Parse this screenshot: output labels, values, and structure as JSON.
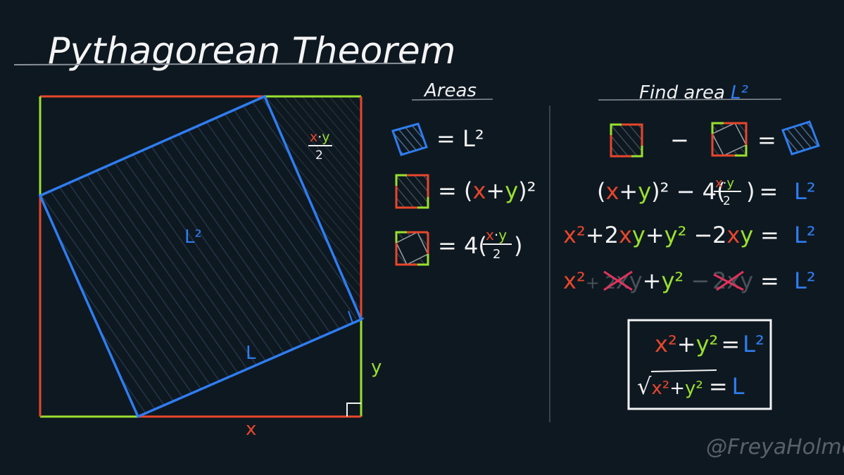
{
  "title": "Pythagorean Theorem",
  "headers": {
    "areas": "Areas",
    "find_area": "Find area",
    "find_area_symbol": "L²"
  },
  "labels": {
    "L_squared": "L²",
    "L": "L",
    "x": "x",
    "y": "y",
    "triangle_num": "x·y",
    "triangle_den": "2"
  },
  "areas": {
    "row1": {
      "rhs": "= L²"
    },
    "row2": {
      "eq": "= (",
      "x": "x",
      "plus": "+",
      "y": "y",
      "close": ")²"
    },
    "row3": {
      "eq": "= 4(",
      "num_x": "x",
      "dot": "·",
      "num_y": "y",
      "den": "2",
      "close": ")"
    }
  },
  "find": {
    "minus": "−",
    "equals": "=",
    "line2": {
      "open": "(",
      "x": "x",
      "plus": "+",
      "y": "y",
      "close": ")² − 4(",
      "num_x": "x",
      "dot": "·",
      "num_y": "y",
      "den": "2",
      "end": ")",
      "eq": "=",
      "rhs": "L²"
    },
    "line3": {
      "x2": "x²",
      "plus1": "+2",
      "xy_x": "x",
      "xy_y": "y",
      "plus2": "+",
      "y2": "y²",
      "minus": " −",
      "two": "2",
      "x": "x",
      "y": "y",
      "eq": "=",
      "rhs": "L²"
    },
    "line4": {
      "x2": "x²",
      "plus1": "+ 2",
      "x": "x",
      "y": "y",
      "plus2": "+",
      "y2": "y²",
      "minus": " −",
      "two": "2",
      "x2b": "x",
      "y2b": "y",
      "eq": "=",
      "rhs": "L²"
    }
  },
  "result": {
    "line1": {
      "x2": "x²",
      "plus": "+",
      "y2": "y²",
      "eq": "=",
      "rhs": "L²"
    },
    "line2": {
      "root": "√",
      "x2": "x²",
      "plus": "+",
      "y2": "y²",
      "eq": "=",
      "rhs": "L"
    }
  },
  "watermark": "@FreyaHolmer",
  "colors": {
    "background": "#0e1821",
    "x_side": "#e8462b",
    "y_side": "#9ae02f",
    "hypotenuse": "#2f7df0",
    "ink": "#f2f2f2"
  }
}
